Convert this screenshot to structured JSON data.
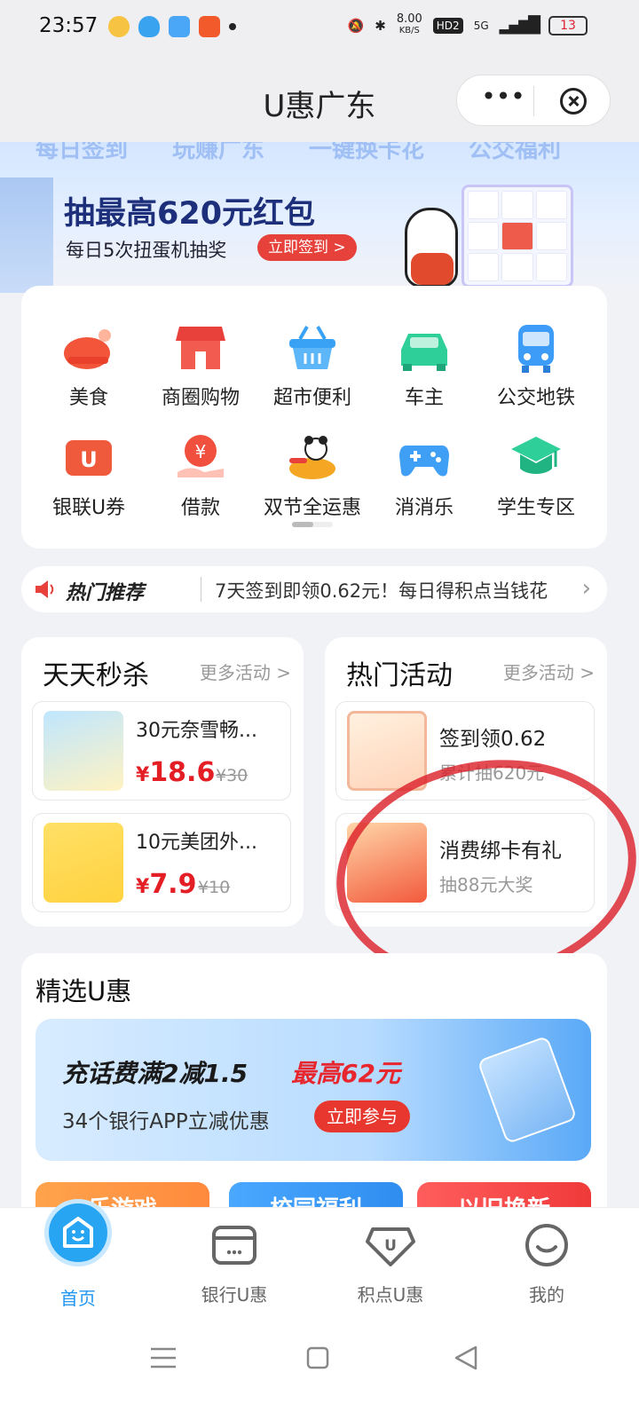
{
  "status_bar": {
    "time": "23:57",
    "network_speed": "8.00",
    "network_speed_unit": "KB/S",
    "hd_badge": "HD2",
    "signal": "5G",
    "battery": "13",
    "app_icons": [
      "coin-app-icon",
      "qq-icon",
      "weather-app-icon",
      "video-app-icon"
    ]
  },
  "title_bar": {
    "title": "U惠广东",
    "more_label": "•••"
  },
  "banner": {
    "tabs": [
      "每日签到",
      "玩赚广东",
      "一键换卡花",
      "公交福利"
    ],
    "title": "抽最高620元红包",
    "subtitle": "每日5次扭蛋机抽奖",
    "cta": "立即签到 >"
  },
  "services": [
    {
      "label": "美食",
      "icon": "food-icon",
      "color": "#f2553a"
    },
    {
      "label": "商圈购物",
      "icon": "store-icon",
      "color": "#e8403a"
    },
    {
      "label": "超市便利",
      "icon": "basket-icon",
      "color": "#3aa2f5"
    },
    {
      "label": "车主",
      "icon": "car-icon",
      "color": "#2fcf9a"
    },
    {
      "label": "公交地铁",
      "icon": "bus-icon",
      "color": "#3d9cf7"
    },
    {
      "label": "银联U券",
      "icon": "coupon-icon",
      "color": "#f05a3c"
    },
    {
      "label": "借款",
      "icon": "loan-icon",
      "color": "#f2503e"
    },
    {
      "label": "双节全运惠",
      "icon": "panda-promo-icon",
      "color": "#f5a623"
    },
    {
      "label": "消消乐",
      "icon": "gamepad-icon",
      "color": "#3f9ff5"
    },
    {
      "label": "学生专区",
      "icon": "graduation-cap-icon",
      "color": "#2fcf9a"
    }
  ],
  "notice": {
    "title": "热门推荐",
    "text": "7天签到即领0.62元！每日得积点当钱花"
  },
  "flash_sale": {
    "title": "天天秒杀",
    "more": "更多活动 >",
    "items": [
      {
        "name": "30元奈雪畅...",
        "currency": "¥",
        "price": "18.6",
        "original": "¥30"
      },
      {
        "name": "10元美团外...",
        "currency": "¥",
        "price": "7.9",
        "original": "¥10"
      }
    ]
  },
  "hot_activities": {
    "title": "热门活动",
    "more": "更多活动 >",
    "items": [
      {
        "name": "签到领0.62",
        "sub": "累计抽620元"
      },
      {
        "name": "消费绑卡有礼",
        "sub": "抽88元大奖"
      }
    ]
  },
  "selected": {
    "title": "精选U惠",
    "promo_main": "充话费满2减1.5",
    "promo_highlight": "最高62元",
    "promo_sub": "34个银行APP立减优惠",
    "promo_cta": "立即参与",
    "tiles": [
      "乐游戏",
      "校园福利",
      "以旧换新"
    ]
  },
  "bottom_nav": [
    {
      "label": "首页",
      "icon": "home-icon"
    },
    {
      "label": "银行U惠",
      "icon": "bank-card-icon"
    },
    {
      "label": "积点U惠",
      "icon": "points-u-icon"
    },
    {
      "label": "我的",
      "icon": "profile-icon"
    }
  ],
  "colors": {
    "accent_red": "#e31e24",
    "accent_blue": "#2196f3",
    "annotation": "#dc1e28"
  }
}
